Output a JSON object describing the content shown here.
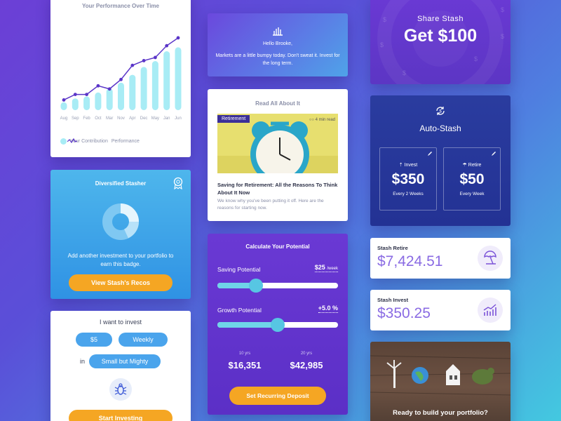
{
  "performance": {
    "title": "Your Performance Over Time",
    "months": [
      "Aug",
      "Sep",
      "Feb",
      "Oct",
      "Mar",
      "Nov",
      "Apr",
      "Dec",
      "May",
      "Jan",
      "Jun"
    ],
    "contribution": [
      2,
      3,
      3.5,
      4.5,
      5.5,
      7,
      9,
      11,
      12.5,
      15,
      16
    ],
    "performance": [
      2.6,
      4,
      4,
      6.2,
      5.4,
      7.8,
      11.4,
      12.6,
      13.4,
      16.4,
      18.4
    ],
    "legend_contribution": "Your Contribution",
    "legend_performance": "Performance",
    "bar_color": "#a8ecf5",
    "line_color": "#5a35c8"
  },
  "diversified": {
    "title": "Diversified Stasher",
    "message": "Add another investment to your portfolio to earn this badge.",
    "button": "View Stash's Recos"
  },
  "invest_form": {
    "title": "I want to invest",
    "amount": "$5",
    "frequency": "Weekly",
    "in_label": "in",
    "stash": "Small but Mighty",
    "button": "Start Investing"
  },
  "hello": {
    "greeting": "Hello Brooke,",
    "message": "Markets are a little bumpy today. Don't sweat it. Invest for the long term."
  },
  "article": {
    "section_title": "Read All About It",
    "tag": "Retirement",
    "read_time": "4 min read",
    "headline": "Saving for Retirement: All the Reasons To Think About It Now",
    "summary": "We know why you've been putting it off. Here are the reasons for starting now."
  },
  "calculator": {
    "title": "Calculate Your Potential",
    "saving_label": "Saving Potential",
    "saving_value": "$25",
    "saving_unit": "/week",
    "saving_level": 0.32,
    "growth_label": "Growth Potential",
    "growth_value": "+5.0 %",
    "growth_level": 0.5,
    "term_1": "10 yrs",
    "amount_1": "$16,351",
    "term_2": "20 yrs",
    "amount_2": "$42,985",
    "button": "Set Recurring Deposit"
  },
  "share": {
    "title": "Share Stash",
    "offer": "Get $100"
  },
  "auto_stash": {
    "title": "Auto-Stash",
    "boxes": [
      {
        "name": "Invest",
        "amount": "$350",
        "frequency": "Every 2 Weeks"
      },
      {
        "name": "Retire",
        "amount": "$50",
        "frequency": "Every Week"
      }
    ]
  },
  "balances": [
    {
      "name": "Stash Retire",
      "amount": "$7,424.51",
      "icon": "umbrella-icon"
    },
    {
      "name": "Stash Invest",
      "amount": "$350.25",
      "icon": "growth-chart-icon"
    }
  ],
  "portfolio": {
    "cta": "Ready to build your portfolio?"
  }
}
